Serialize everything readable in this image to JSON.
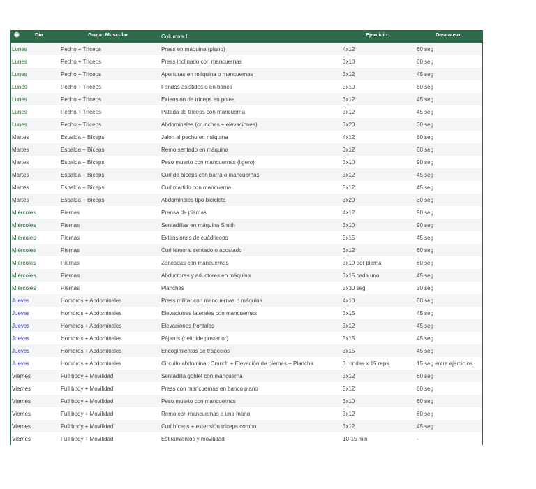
{
  "headers": {
    "dia": "Dia",
    "grupo": "Grupo Muscular",
    "col1": "Columna 1",
    "ejercicio": "Ejercicio",
    "descanso": "Descanso"
  },
  "day_colors": {
    "Lunes": "#2e6b2e",
    "Martes": "#3c3c3c",
    "Miércoles": "#1f5a2f",
    "Jueves": "#3b3f9a",
    "Viernes": "#333333"
  },
  "rows": [
    [
      "Lunes",
      "Pecho + Tríceps",
      "Press en máquina (plano)",
      "4x12",
      "60 seg"
    ],
    [
      "Lunes",
      "Pecho + Tríceps",
      "Press inclinado con mancuernas",
      "3x10",
      "60 seg"
    ],
    [
      "Lunes",
      "Pecho + Tríceps",
      "Aperturas en máquina o mancuernas",
      "3x12",
      "45 seg"
    ],
    [
      "Lunes",
      "Pecho + Tríceps",
      "Fondos asistidos o en banco",
      "3x10",
      "60 seg"
    ],
    [
      "Lunes",
      "Pecho + Tríceps",
      "Extensión de tríceps en polea",
      "3x12",
      "45 seg"
    ],
    [
      "Lunes",
      "Pecho + Tríceps",
      "Patada de tríceps con mancuerna",
      "3x12",
      "45 seg"
    ],
    [
      "Lunes",
      "Pecho + Tríceps",
      "Abdominales (crunches + elevaciones)",
      "3x20",
      "30 seg"
    ],
    [
      "Martes",
      "Espalda + Bíceps",
      "Jalón al pecho en máquina",
      "4x12",
      "60 seg"
    ],
    [
      "Martes",
      "Espalda + Bíceps",
      "Remo sentado en máquina",
      "3x12",
      "60 seg"
    ],
    [
      "Martes",
      "Espalda + Bíceps",
      "Peso muerto con mancuernas (ligero)",
      "3x10",
      "90 seg"
    ],
    [
      "Martes",
      "Espalda + Bíceps",
      "Curl de bíceps con barra o mancuernas",
      "3x12",
      "45 seg"
    ],
    [
      "Martes",
      "Espalda + Bíceps",
      "Curl martillo con mancuerna",
      "3x12",
      "45 seg"
    ],
    [
      "Martes",
      "Espalda + Bíceps",
      "Abdominales tipo bicicleta",
      "3x20",
      "30 seg"
    ],
    [
      "Miércoles",
      "Piernas",
      "Prensa de piernas",
      "4x12",
      "90 seg"
    ],
    [
      "Miércoles",
      "Piernas",
      "Sentadillas en máquina Smith",
      "3x10",
      "90 seg"
    ],
    [
      "Miércoles",
      "Piernas",
      "Extensiones de cuádriceps",
      "3x15",
      "45 seg"
    ],
    [
      "Miércoles",
      "Piernas",
      "Curl femoral sentado o acostado",
      "3x12",
      "60 seg"
    ],
    [
      "Miércoles",
      "Piernas",
      "Zancadas con mancuernas",
      "3x10 por pierna",
      "60 seg"
    ],
    [
      "Miércoles",
      "Piernas",
      "Abductores y aductores en máquina",
      "3x15 cada uno",
      "45 seg"
    ],
    [
      "Miércoles",
      "Piernas",
      "Planchas",
      "3x30 seg",
      "30 seg"
    ],
    [
      "Jueves",
      "Hombros + Abdominales",
      "Press militar con mancuernas o máquina",
      "4x10",
      "60 seg"
    ],
    [
      "Jueves",
      "Hombros + Abdominales",
      "Elevaciones laterales con mancuernas",
      "3x15",
      "45 seg"
    ],
    [
      "Jueves",
      "Hombros + Abdominales",
      "Elevaciones frontales",
      "3x12",
      "45 seg"
    ],
    [
      "Jueves",
      "Hombros + Abdominales",
      "Pájaros (deltoide posterior)",
      "3x15",
      "45 seg"
    ],
    [
      "Jueves",
      "Hombros + Abdominales",
      "Encogimientos de trapecios",
      "3x15",
      "45 seg"
    ],
    [
      "Jueves",
      "Hombros + Abdominales",
      "Circuito abdominal: Crunch + Elevación de piernas + Plancha",
      "3 rondas x 15 reps",
      "15 seg entre ejercicios"
    ],
    [
      "Viernes",
      "Full body + Movilidad",
      "Sentadilla goblet con mancuerna",
      "3x12",
      "60 seg"
    ],
    [
      "Viernes",
      "Full body + Movilidad",
      "Press con mancuernas en banco plano",
      "3x12",
      "60 seg"
    ],
    [
      "Viernes",
      "Full body + Movilidad",
      "Peso muerto con mancuernas",
      "3x10",
      "60 seg"
    ],
    [
      "Viernes",
      "Full body + Movilidad",
      "Remo con mancuernas a una mano",
      "3x12",
      "60 seg"
    ],
    [
      "Viernes",
      "Full body + Movilidad",
      "Curl bíceps + extensión tríceps combo",
      "3x12",
      "45 seg"
    ],
    [
      "Viernes",
      "Full body + Movilidad",
      "Estiramientos y movilidad",
      "10-15 min",
      "-"
    ]
  ]
}
